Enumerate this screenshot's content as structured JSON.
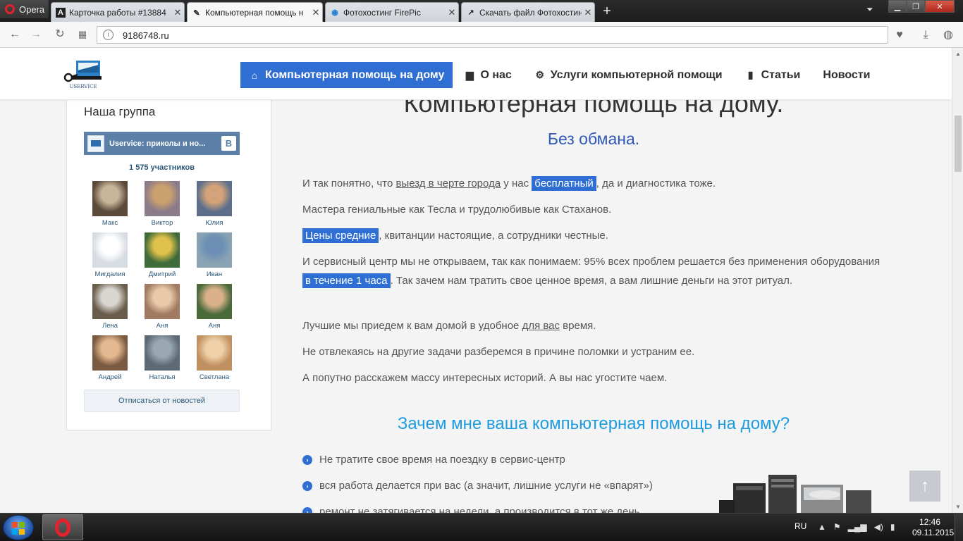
{
  "browser": {
    "menu_label": "Opera",
    "tabs": [
      {
        "label": "Карточка работы #13884",
        "fav": "A"
      },
      {
        "label": "Компьютерная помощь н",
        "fav": "✎"
      },
      {
        "label": "Фотохостинг FirePic",
        "fav": "◉"
      },
      {
        "label": "Скачать файл Фотохостин",
        "fav": "↗"
      }
    ],
    "new_tab": "+",
    "url": "9186748.ru"
  },
  "site": {
    "logo_text": "USERVICE",
    "nav": [
      {
        "label": "Компьютерная помощь на дому",
        "icon": "home-icon",
        "glyph": "⌂"
      },
      {
        "label": "О нас",
        "icon": "briefcase-icon",
        "glyph": "▆"
      },
      {
        "label": "Услуги компьютерной помощи",
        "icon": "gear-icon",
        "glyph": "⚙"
      },
      {
        "label": "Статьи",
        "icon": "book-icon",
        "glyph": "▮"
      },
      {
        "label": "Новости",
        "icon": "",
        "glyph": ""
      }
    ]
  },
  "sidebar": {
    "title": "Наша группа",
    "group_name": "Uservice: приколы и но...",
    "vk_logo": "B",
    "members_count": "1 575 участников",
    "members": [
      {
        "name": "Макс",
        "c1": "#5b4a3a",
        "c2": "#c8b59a"
      },
      {
        "name": "Виктор",
        "c1": "#8b7b8a",
        "c2": "#c9a06e"
      },
      {
        "name": "Юлия",
        "c1": "#5c6e8a",
        "c2": "#d4a37a"
      },
      {
        "name": "Мигдалия",
        "c1": "#d8dde3",
        "c2": "#ffffff"
      },
      {
        "name": "Дмитрий",
        "c1": "#3f6b3a",
        "c2": "#e0c14b"
      },
      {
        "name": "Иван",
        "c1": "#8aa3b3",
        "c2": "#6d8fb6"
      },
      {
        "name": "Лена",
        "c1": "#6a5d4c",
        "c2": "#d9d6d0"
      },
      {
        "name": "Аня",
        "c1": "#a07a62",
        "c2": "#e8c9a8"
      },
      {
        "name": "Аня",
        "c1": "#4a6a3a",
        "c2": "#d9b08a"
      },
      {
        "name": "Андрей",
        "c1": "#7a5a40",
        "c2": "#e4b890"
      },
      {
        "name": "Наталья",
        "c1": "#5d6a75",
        "c2": "#9aa8b4"
      },
      {
        "name": "Светлана",
        "c1": "#c09060",
        "c2": "#f0d0a8"
      }
    ],
    "unsubscribe": "Отписаться от новостей"
  },
  "main": {
    "title": "Компьютерная помощь на дому.",
    "subtitle": "Без обмана.",
    "p1_a": "И так понятно, что ",
    "p1_u": "выезд в черте города",
    "p1_b": " у нас ",
    "p1_hl": "бесплатный",
    "p1_c": ", да и диагностика тоже.",
    "p2": "Мастера гениальные как Тесла и трудолюбивые как Стаханов.",
    "p3_hl": "Цены средние",
    "p3_b": ", квитанции настоящие, а сотрудники честные.",
    "p4_a": "И сервисный центр мы не открываем, так как понимаем: 95% всех проблем решается без применения оборудования ",
    "p4_hl": "в течение 1 часа",
    "p4_b": ".  Так зачем нам тратить свое ценное время, а вам лишние деньги на этот ритуал.",
    "p5_a": "Лучшие мы приедем к вам домой в удобное ",
    "p5_u": "для вас",
    "p5_b": " время.",
    "p6": "Не отвлекаясь на другие задачи разберемся в причине поломки и устраним ее.",
    "p7": "А попутно расскажем массу интересных историй. А вы нас угостите чаем.",
    "h2": "Зачем мне ваша компьютерная помощь на дому?",
    "bullets": [
      "Не тратите свое время на поездку в сервис-центр",
      "вся работа делается при вас (а значит, лишние услуги не «впарят»)",
      "ремонт не затягивается на недели, а производится в тот же день"
    ],
    "to_top": "↑"
  },
  "taskbar": {
    "lang": "RU",
    "time": "12:46",
    "date": "09.11.2015"
  },
  "colors": {
    "accent": "#2f6fd3",
    "heading_blue": "#1e9be0",
    "vk_blue": "#5b7fa6"
  }
}
